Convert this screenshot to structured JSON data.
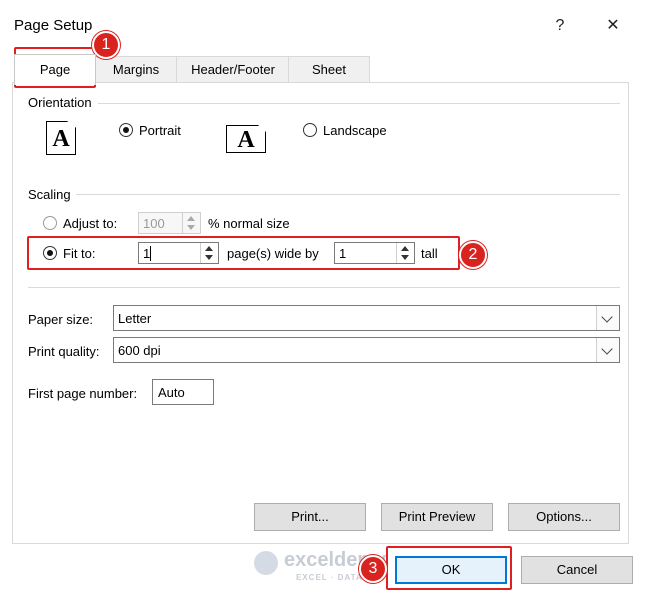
{
  "window": {
    "title": "Page Setup",
    "help_label": "?",
    "close_label": "✕"
  },
  "tabs": [
    {
      "label": "Page",
      "active": true
    },
    {
      "label": "Margins",
      "active": false
    },
    {
      "label": "Header/Footer",
      "active": false
    },
    {
      "label": "Sheet",
      "active": false
    }
  ],
  "orientation": {
    "group_label": "Orientation",
    "portrait_label": "Portrait",
    "landscape_label": "Landscape",
    "icon_glyph": "A",
    "selected": "portrait"
  },
  "scaling": {
    "group_label": "Scaling",
    "adjust_label": "Adjust to:",
    "adjust_value": "100",
    "adjust_suffix": "% normal size",
    "fit_label": "Fit to:",
    "wide_value": "1",
    "wide_suffix": "page(s) wide by",
    "tall_value": "1",
    "tall_suffix": "tall",
    "selected": "fit"
  },
  "paper": {
    "size_label": "Paper size:",
    "size_value": "Letter",
    "quality_label": "Print quality:",
    "quality_value": "600 dpi",
    "first_page_label": "First page number:",
    "first_page_value": "Auto"
  },
  "buttons": {
    "print": "Print...",
    "print_preview": "Print Preview",
    "options": "Options...",
    "ok": "OK",
    "cancel": "Cancel"
  },
  "annotations": {
    "step1": "1",
    "step2": "2",
    "step3": "3",
    "color": "#d9231f"
  },
  "watermark": {
    "name": "exceldemy",
    "tagline": "EXCEL · DATA"
  }
}
